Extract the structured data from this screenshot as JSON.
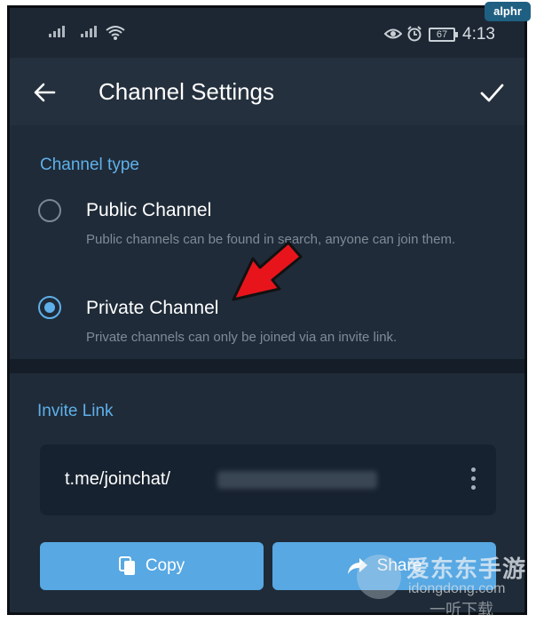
{
  "status": {
    "battery": "67",
    "time": "4:13"
  },
  "header": {
    "title": "Channel Settings"
  },
  "channel_type": {
    "heading": "Channel type",
    "public": {
      "label": "Public Channel",
      "description": "Public channels can be found in search, anyone can join them."
    },
    "private": {
      "label": "Private Channel",
      "description": "Private channels can only be joined via an invite link."
    },
    "selected": "private"
  },
  "invite": {
    "heading": "Invite Link",
    "link_prefix": "t.me/joinchat/",
    "copy_label": "Copy",
    "share_label": "Share"
  },
  "watermark": {
    "brand": "alphr",
    "cn": "爱东东手游",
    "en": "idongdong.com",
    "cn2": "一听下载"
  },
  "colors": {
    "accent": "#5fb0ea",
    "button": "#57a8e3",
    "arrow": "#e8141c"
  }
}
